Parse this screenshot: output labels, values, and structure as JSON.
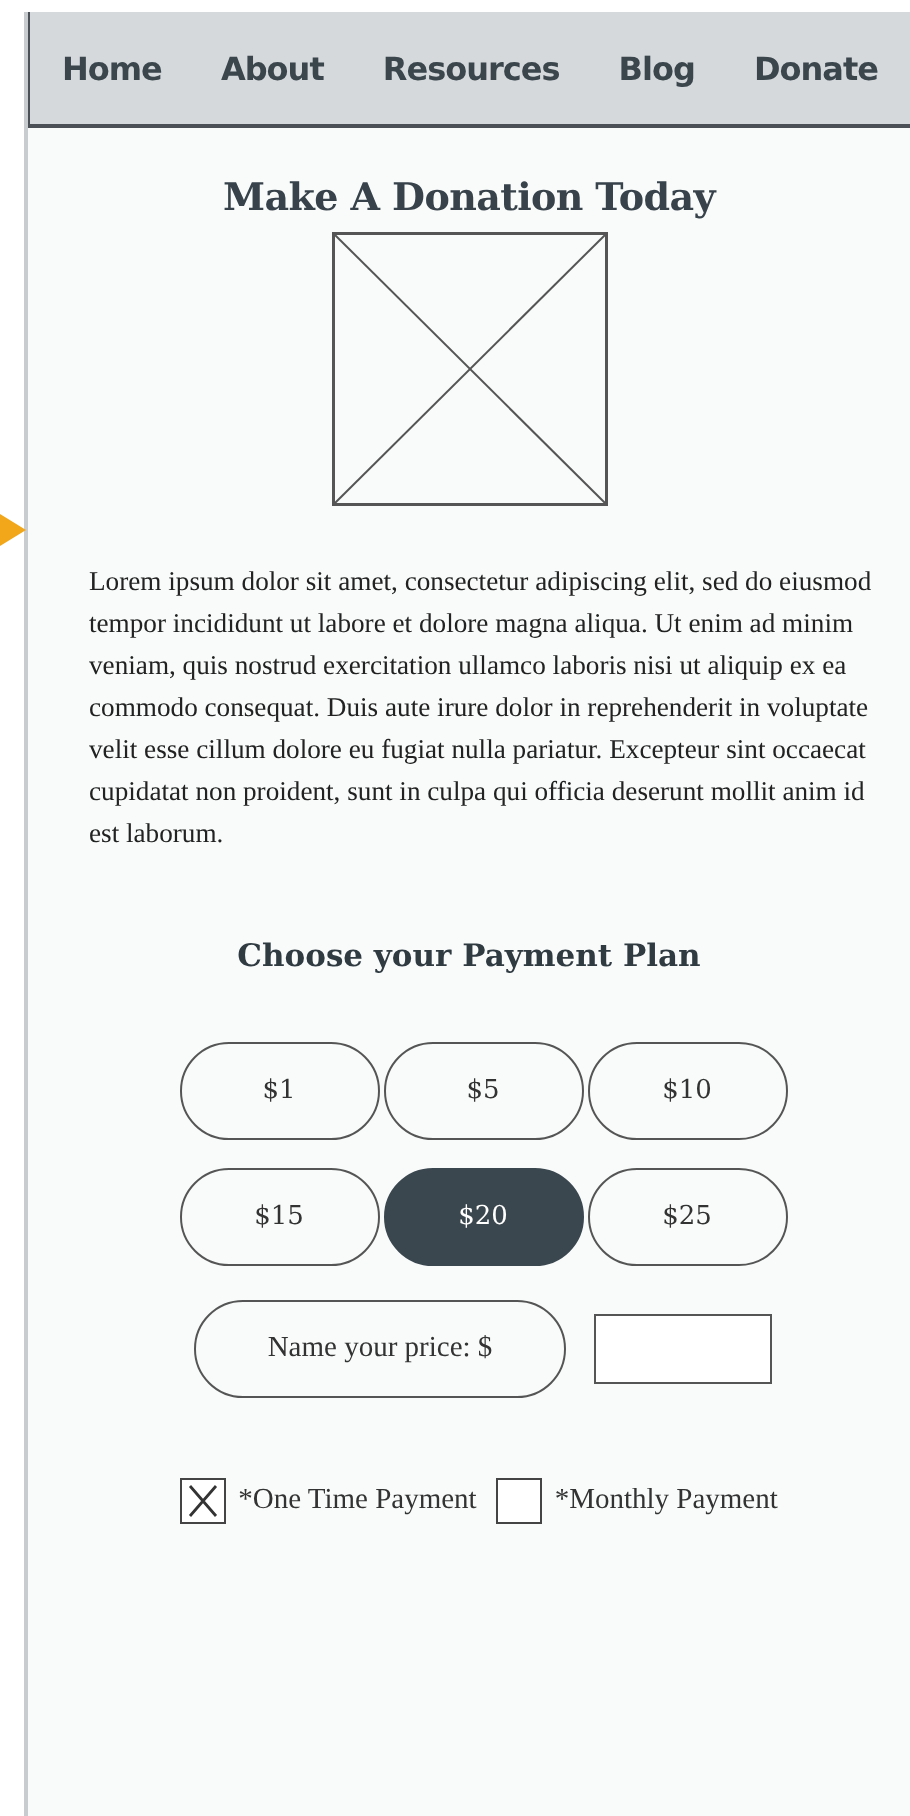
{
  "nav": {
    "items": [
      {
        "label": "Home"
      },
      {
        "label": "About"
      },
      {
        "label": "Resources"
      },
      {
        "label": "Blog"
      },
      {
        "label": "Donate"
      }
    ]
  },
  "title": "Make A Donation Today",
  "body": "Lorem ipsum dolor sit amet, consectetur adipiscing elit, sed do eiusmod tempor incididunt ut labore et dolore magna aliqua. Ut enim ad minim veniam, quis nostrud exercitation ullamco laboris nisi ut aliquip ex ea commodo consequat. Duis aute irure dolor in reprehenderit in voluptate velit esse cillum dolore eu fugiat nulla pariatur. Excepteur sint occaecat cupidatat non proident, sunt in culpa qui officia deserunt mollit anim id est laborum.",
  "payment_plan": {
    "heading": "Choose your Payment Plan",
    "amounts": [
      {
        "label": "$1",
        "selected": false
      },
      {
        "label": "$5",
        "selected": false
      },
      {
        "label": "$10",
        "selected": false
      },
      {
        "label": "$15",
        "selected": false
      },
      {
        "label": "$20",
        "selected": true
      },
      {
        "label": "$25",
        "selected": false
      }
    ],
    "custom": {
      "label": "Name your price: $"
    },
    "frequency": [
      {
        "label": "*One Time Payment",
        "checked": true
      },
      {
        "label": "*Monthly Payment",
        "checked": false
      }
    ]
  }
}
